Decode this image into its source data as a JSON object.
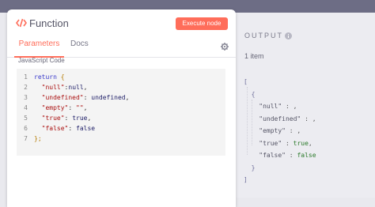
{
  "node": {
    "title": "Function",
    "execute_label": "Execute node",
    "tabs": [
      {
        "label": "Parameters"
      },
      {
        "label": "Docs"
      }
    ],
    "field_label": "JavaScript Code",
    "code_line_numbers": [
      "1",
      "2",
      "3",
      "4",
      "5",
      "6",
      "7"
    ],
    "code": {
      "l1_kw": "return",
      "l1_brace": "{",
      "l2_key": "\"null\"",
      "l2_sep": ":",
      "l2_val": "null",
      "l2_comma": ",",
      "l3_key": "\"undefined\"",
      "l3_sep": ": ",
      "l3_val": "undefined",
      "l3_comma": ",",
      "l4_key": "\"empty\"",
      "l4_sep": ": ",
      "l4_val": "\"\"",
      "l4_comma": ",",
      "l5_key": "\"true\"",
      "l5_sep": ": ",
      "l5_val": "true",
      "l5_comma": ",",
      "l6_key": "\"false\"",
      "l6_sep": ": ",
      "l6_val": "false",
      "l7_brace": "};"
    }
  },
  "output": {
    "title": "OUTPUT",
    "item_count": "1 item",
    "json_lines": {
      "open_array": "[",
      "open_object": "{",
      "k_null": "\"null\"",
      "k_null_sep": " : ,",
      "k_undefined": "\"undefined\"",
      "k_undefined_sep": " : ,",
      "k_empty": "\"empty\"",
      "k_empty_sep": " : ,",
      "k_true": "\"true\"",
      "k_true_sep": " : ",
      "k_true_val": "true",
      "k_true_comma": ",",
      "k_false": "\"false\"",
      "k_false_sep": " : ",
      "k_false_val": "false",
      "close_object": "}",
      "close_array": "]"
    }
  },
  "colors": {
    "accent": "#ff6d5a",
    "output_bg": "#ececf1",
    "code_bg": "#f4f4f4"
  },
  "icons": [
    "function-icon",
    "gear-icon",
    "info-icon"
  ]
}
